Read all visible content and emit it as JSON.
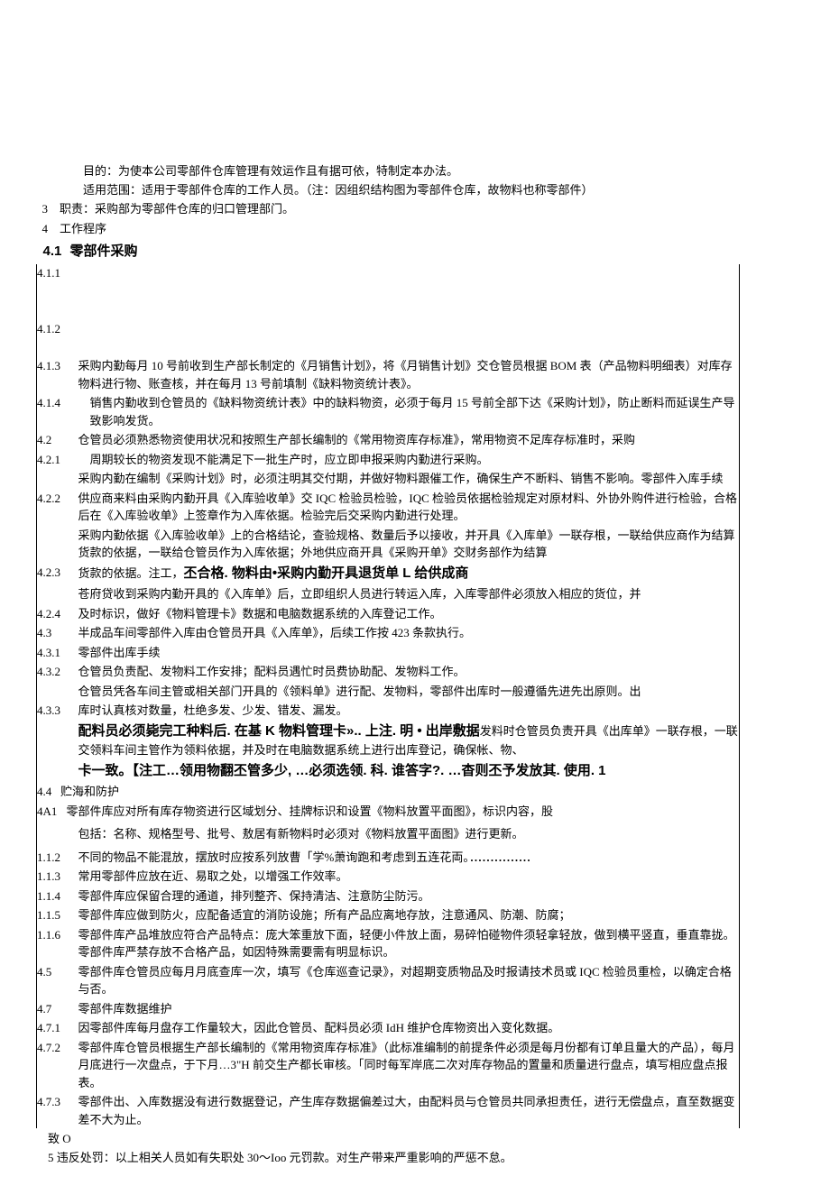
{
  "header": {
    "purpose": "目的：为使本公司零部件仓库管理有效运作且有据可依，特制定本办法。",
    "scope": "适用范围：适用于零部件仓库的工作人员。（注：因组织结构图为零部件仓库，故物料也称零部件）",
    "l3_num": "3",
    "l3_text": "职责：采购部为零部件仓库的归口管理部门。",
    "l4_num": "4",
    "l4_text": "工作程序",
    "l41_num": "4.1",
    "l41_text": "零部件采购"
  },
  "items": {
    "n411": "4.1.1",
    "n412": "4.1.2",
    "n413": "4.1.3",
    "t413": "采购内勤每月 10 号前收到生产部长制定的《月销售计划》，将《月销售计划》交仓管员根据 BOM 表（产品物料明细表）对库存物料进行物、账查核，并在每月 13 号前填制《缺料物资统计表》。",
    "n414": "4.1.4",
    "t414": "销售内勤收到仓管员的《缺料物资统计表》中的缺料物资，必须于每月 15 号前全部下达《采购计划》，防止断料而延误生产导致影响发货。",
    "n42": "4.2",
    "t42": "仓管员必须熟悉物资使用状况和按照生产部长编制的《常用物资库存标准》，常用物资不足库存标准时，采购",
    "n421": "4.2.1",
    "t421a": "周期较长的物资发现不能满足下一批生产时，应立即申报采购内勤进行采购。",
    "t421b": "采购内勤在编制《采购计划》时，必须注明其交付期，并做好物料跟催工作，确保生产不断料、销售不影响。零部件入库手续",
    "n422": "4.2.2",
    "t422a": "供应商来料由采购内勤开具《入库验收单》交 IQC 检验员检验，IQC 检验员依据检验规定对原材料、外协外购件进行检验，合格后在《入库验收单》上签章作为入库依据。检验完后交采购内勤进行处理。",
    "t422b": "采购内勤依据《入库验收单》上的合格结论，查验规格、数量后予以接收，并开具《入库单》一联存根，一联给供应商作为结算货款的依据，一联给仓管员作为入库依据；外地供应商开具《采购开单》交财务部作为结算",
    "n423": "4.2.3",
    "t423p": "货款的依据。注工，",
    "t423b": "丕合格. 物料由•采购内勤开具退货单 L 给供成商",
    "t423c": "苍府贷收到采购内勤开具的《入库单》后，立即组织人员进行转运入库，入库零部件必须放入相应的货位，并",
    "n424": "4.2.4",
    "t424": "及时标识，做好《物料管理卡》数据和电脑数据系统的入库登记工作。",
    "n43": "4.3",
    "t43": "半成品车间零部件入库由仓管员开具《入库单》，后续工作按 423 条款执行。",
    "n431": "4.3.1",
    "t431": "零部件出库手续",
    "n432": "4.3.2",
    "t432a": "仓管员负责配、发物料工作安排；配料员遇忙时员费协助配、发物料工作。",
    "t432b": "仓管员凭各车间主管或相关部门开具的《领料单》进行配、发物料，零部件出库时一般遵循先进先出原则。出",
    "n433": "4.3.3",
    "t433a": "库时认真核对数量，杜绝多发、少发、错发、漏发。",
    "t433b": "配料员必须毙完工种料后. 在基 K 物料管理卡».. 上注. 明 • 出岸敷据",
    "t433c": "发料时仓管员负责开具《出库单》一联存根，一联交领料车间主管作为领料依据，并及时在电脑数据系统上进行出库登记，确保帐、物、",
    "t433d": "卡一致。【注工…领用物翻丕管多少, …必须选领. 科. 谁答字?. …杳则丕予发放其. 使用. 1",
    "n44": "4.4",
    "t44": "贮海和防护",
    "n4a1": "4A1",
    "t4a1a": "零部件库应对所有库存物资进行区域划分、挂牌标识和设置《物料放置平面图》，标识内容，股",
    "t4a1b": "包括：名称、规格型号、批号、敖居有新物料时必须对《物料放置平面图》进行更新。",
    "n112": "1.1.2",
    "t112": "不同的物品不能混放，摆放时应按系列放曹「学%萧询跑和考虑到五连花両。",
    "n113": "1.1.3",
    "t113": "常用零部件应放在近、易取之处，以增强工作效率。",
    "n114": "1.1.4",
    "t114": "零部件库应保留合理的通道，排列整齐、保持清洁、注意防尘防污。",
    "n115": "1.1.5",
    "t115": "零部件库应做到防火，应配备适宜的消防设施；所有产品应离地存放，注意通风、防潮、防腐；",
    "n116": "1.1.6",
    "t116": "零部件库产品堆放应符合产品特点：庞大笨重放下面，轻便小件放上面，易碎怕碰物件须轻拿轻放，做到横平竖直，垂直靠拢。零部件库严禁存放不合格产品，如因特殊需要需有明显标识。",
    "n45": "4.5",
    "t45": "零部件库仓管员应每月月底查库一次，填写《仓库巡查记录》，对超期变质物品及时报请技术员或 IQC 检验员重检，以确定合格与否。",
    "n47": "4.7",
    "t47": "零部件库数据维护",
    "n471": "4.7.1",
    "t471": "因零部件库每月盘存工作量较大，因此仓管员、配料员必须 IdH 维护仓库物资出入变化数据。",
    "n472": "4.7.2",
    "t472": "零部件库仓管员根据生产部长编制的《常用物资库存标准》（此标准编制的前提条件必须是每月份都有订单且量大的产品），每月月底进行一次盘点，于下月…3\"H 前交生产都长审核。「同时每军岸底二次对库存物品的置量和质量进行盘点，填写相应盘点报表。",
    "n473": "4.7.3",
    "t473": "零部件出、入库数据没有进行数据登记，产生库存数据偏差过大，由配料员与仓管员共同承担责任，进行无偿盘点，直至数据变差不大为止。",
    "zo": "致 O",
    "l5": "5 违反处罚：以上相关人员如有失职处 30〜Ioo 元罚款。对生产带来严重影响的严惩不怠。"
  }
}
